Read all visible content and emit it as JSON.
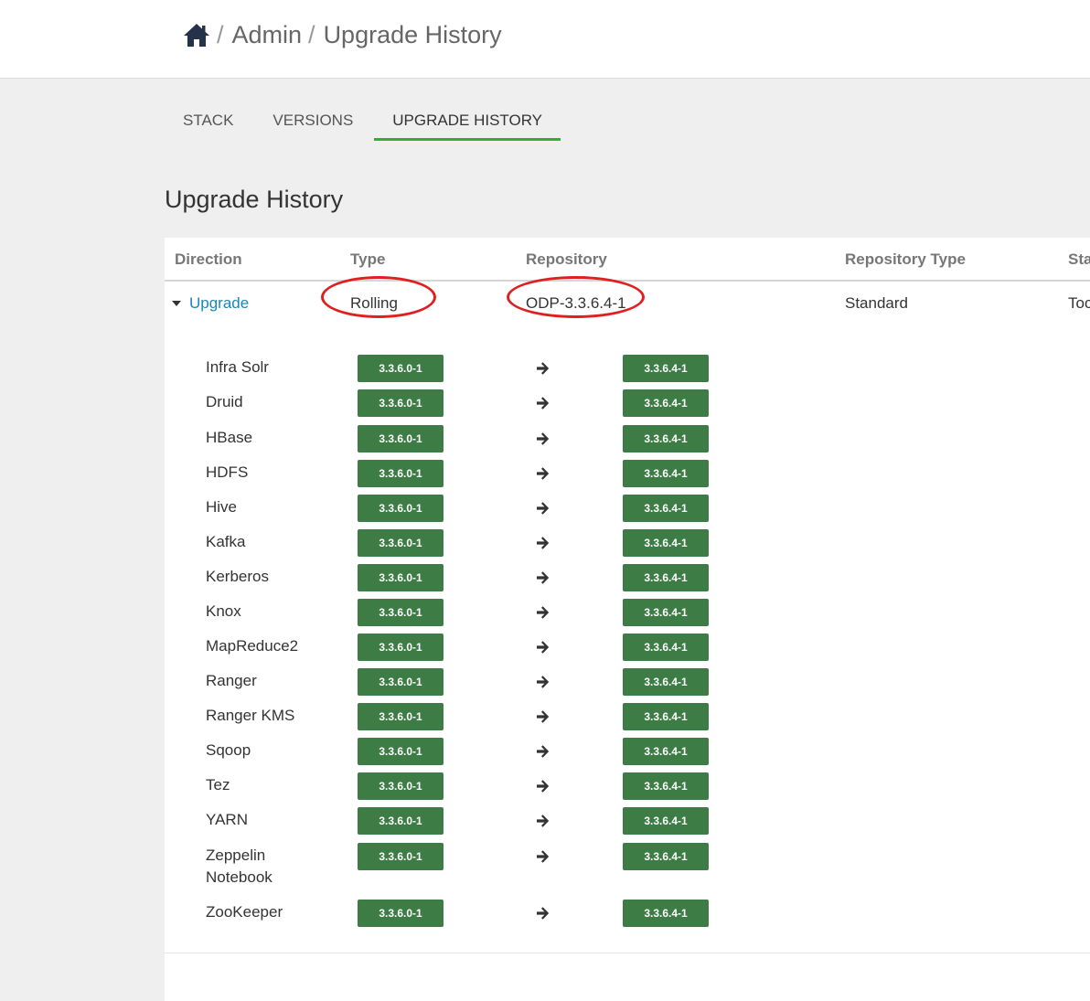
{
  "breadcrumb": {
    "home_icon": "home-icon",
    "items": [
      "Admin",
      "Upgrade History"
    ]
  },
  "tabs": [
    {
      "label": "STACK",
      "active": false
    },
    {
      "label": "VERSIONS",
      "active": false
    },
    {
      "label": "UPGRADE HISTORY",
      "active": true
    }
  ],
  "page_title": "Upgrade History",
  "table": {
    "columns": [
      "Direction",
      "Type",
      "Repository",
      "Repository Type",
      "Sta"
    ],
    "row": {
      "direction": "Upgrade",
      "type": "Rolling",
      "repository": "ODP-3.3.6.4-1",
      "repository_type": "Standard",
      "status": "Toc"
    },
    "services": [
      {
        "name": "Infra Solr",
        "from": "3.3.6.0-1",
        "to": "3.3.6.4-1"
      },
      {
        "name": "Druid",
        "from": "3.3.6.0-1",
        "to": "3.3.6.4-1"
      },
      {
        "name": "HBase",
        "from": "3.3.6.0-1",
        "to": "3.3.6.4-1"
      },
      {
        "name": "HDFS",
        "from": "3.3.6.0-1",
        "to": "3.3.6.4-1"
      },
      {
        "name": "Hive",
        "from": "3.3.6.0-1",
        "to": "3.3.6.4-1"
      },
      {
        "name": "Kafka",
        "from": "3.3.6.0-1",
        "to": "3.3.6.4-1"
      },
      {
        "name": "Kerberos",
        "from": "3.3.6.0-1",
        "to": "3.3.6.4-1"
      },
      {
        "name": "Knox",
        "from": "3.3.6.0-1",
        "to": "3.3.6.4-1"
      },
      {
        "name": "MapReduce2",
        "from": "3.3.6.0-1",
        "to": "3.3.6.4-1"
      },
      {
        "name": "Ranger",
        "from": "3.3.6.0-1",
        "to": "3.3.6.4-1"
      },
      {
        "name": "Ranger KMS",
        "from": "3.3.6.0-1",
        "to": "3.3.6.4-1"
      },
      {
        "name": "Sqoop",
        "from": "3.3.6.0-1",
        "to": "3.3.6.4-1"
      },
      {
        "name": "Tez",
        "from": "3.3.6.0-1",
        "to": "3.3.6.4-1"
      },
      {
        "name": "YARN",
        "from": "3.3.6.0-1",
        "to": "3.3.6.4-1"
      },
      {
        "name": "Zeppelin Notebook",
        "from": "3.3.6.0-1",
        "to": "3.3.6.4-1"
      },
      {
        "name": "ZooKeeper",
        "from": "3.3.6.0-1",
        "to": "3.3.6.4-1"
      }
    ]
  },
  "colors": {
    "version_badge": "#3d7d45",
    "active_tab_underline": "#3aa935",
    "link": "#1a86b8",
    "annotation": "#e02020"
  },
  "icons": {
    "arrow": "arrow-right-icon",
    "caret": "caret-down-icon"
  }
}
